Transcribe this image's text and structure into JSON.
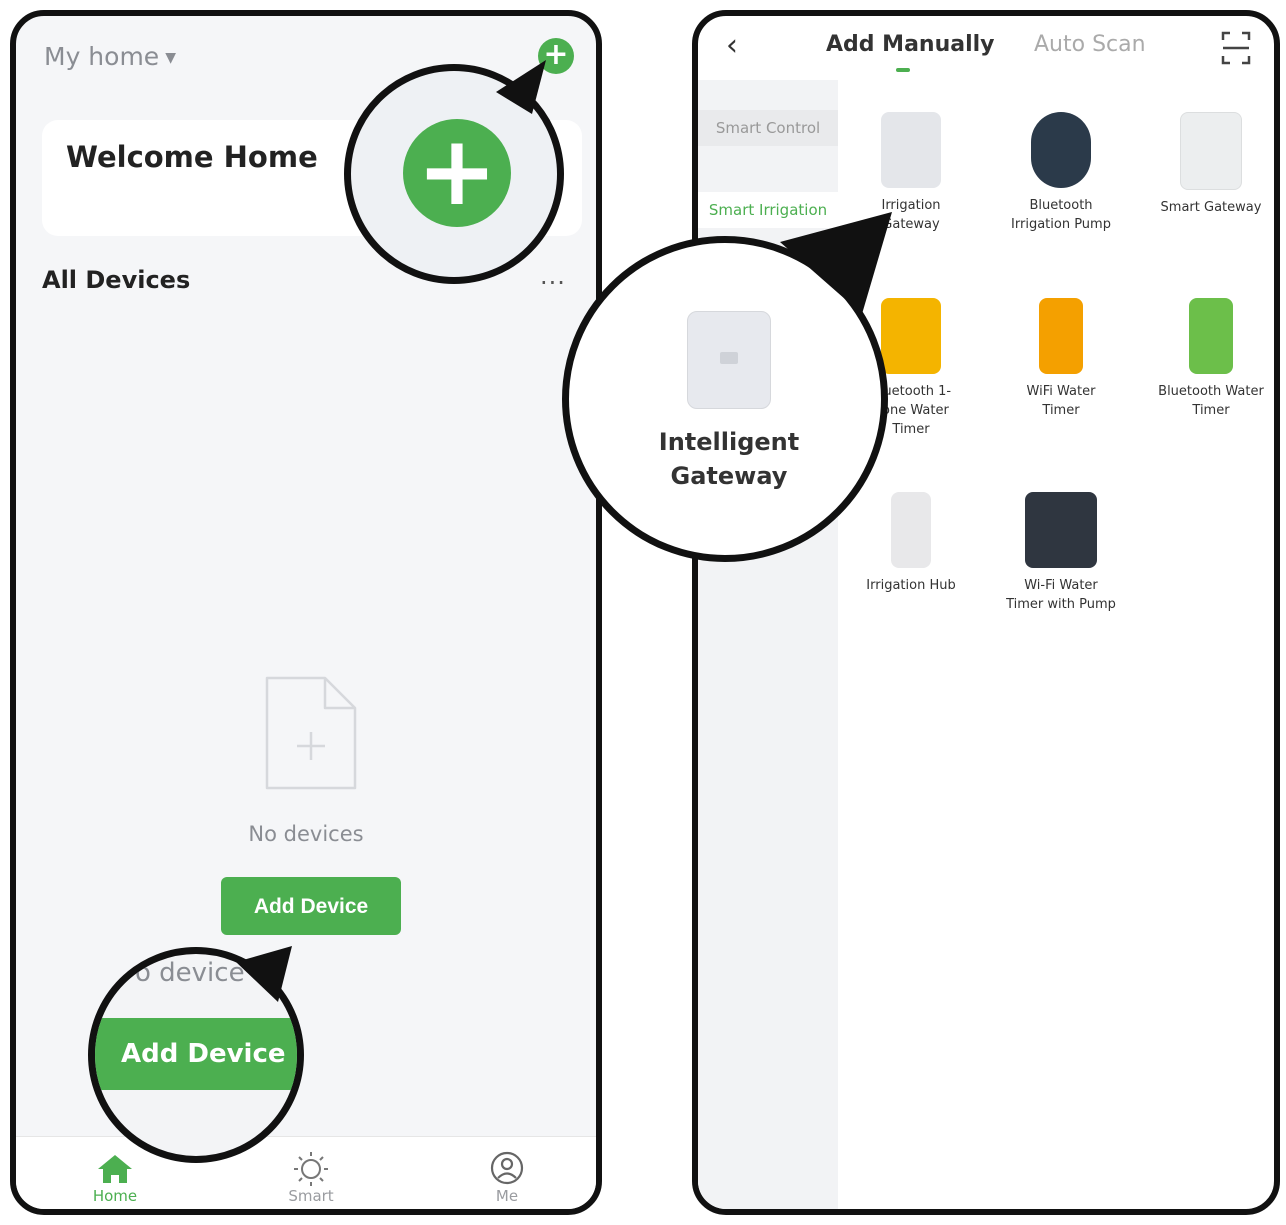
{
  "home_screen": {
    "home_selector": "My home",
    "welcome_title": "Welcome Home",
    "section_title": "All Devices",
    "more_label": "...",
    "empty_text": "No devices",
    "add_device_label": "Add Device",
    "tabs": [
      {
        "label": "Home",
        "icon": "home-icon",
        "active": true
      },
      {
        "label": "Smart",
        "icon": "sun-icon",
        "active": false
      },
      {
        "label": "Me",
        "icon": "user-icon",
        "active": false
      }
    ],
    "zoom_add_faded": "o device",
    "accent_color": "#4caf50"
  },
  "add_screen": {
    "tabs": [
      "Add Manually",
      "Auto Scan"
    ],
    "categories": [
      "Smart Control",
      "Smart Irrigation"
    ],
    "devices": [
      {
        "name": "Irrigation Gateway",
        "color": "#e4e6ea"
      },
      {
        "name": "Bluetooth Irrigation Pump",
        "color": "#2b3a4a"
      },
      {
        "name": "Smart Gateway",
        "color": "#eceeef"
      },
      {
        "name": "Bluetooth 1-Zone Water Timer",
        "color": "#f4b400"
      },
      {
        "name": "WiFi Water Timer",
        "color": "#f4a000"
      },
      {
        "name": "Bluetooth Water Timer",
        "color": "#6cbf4a"
      },
      {
        "name": "Irrigation Hub",
        "color": "#e8e8ea"
      },
      {
        "name": "Wi-Fi Water Timer with Pump",
        "color": "#2f3640"
      }
    ],
    "zoom_label": "Intelligent Gateway"
  }
}
